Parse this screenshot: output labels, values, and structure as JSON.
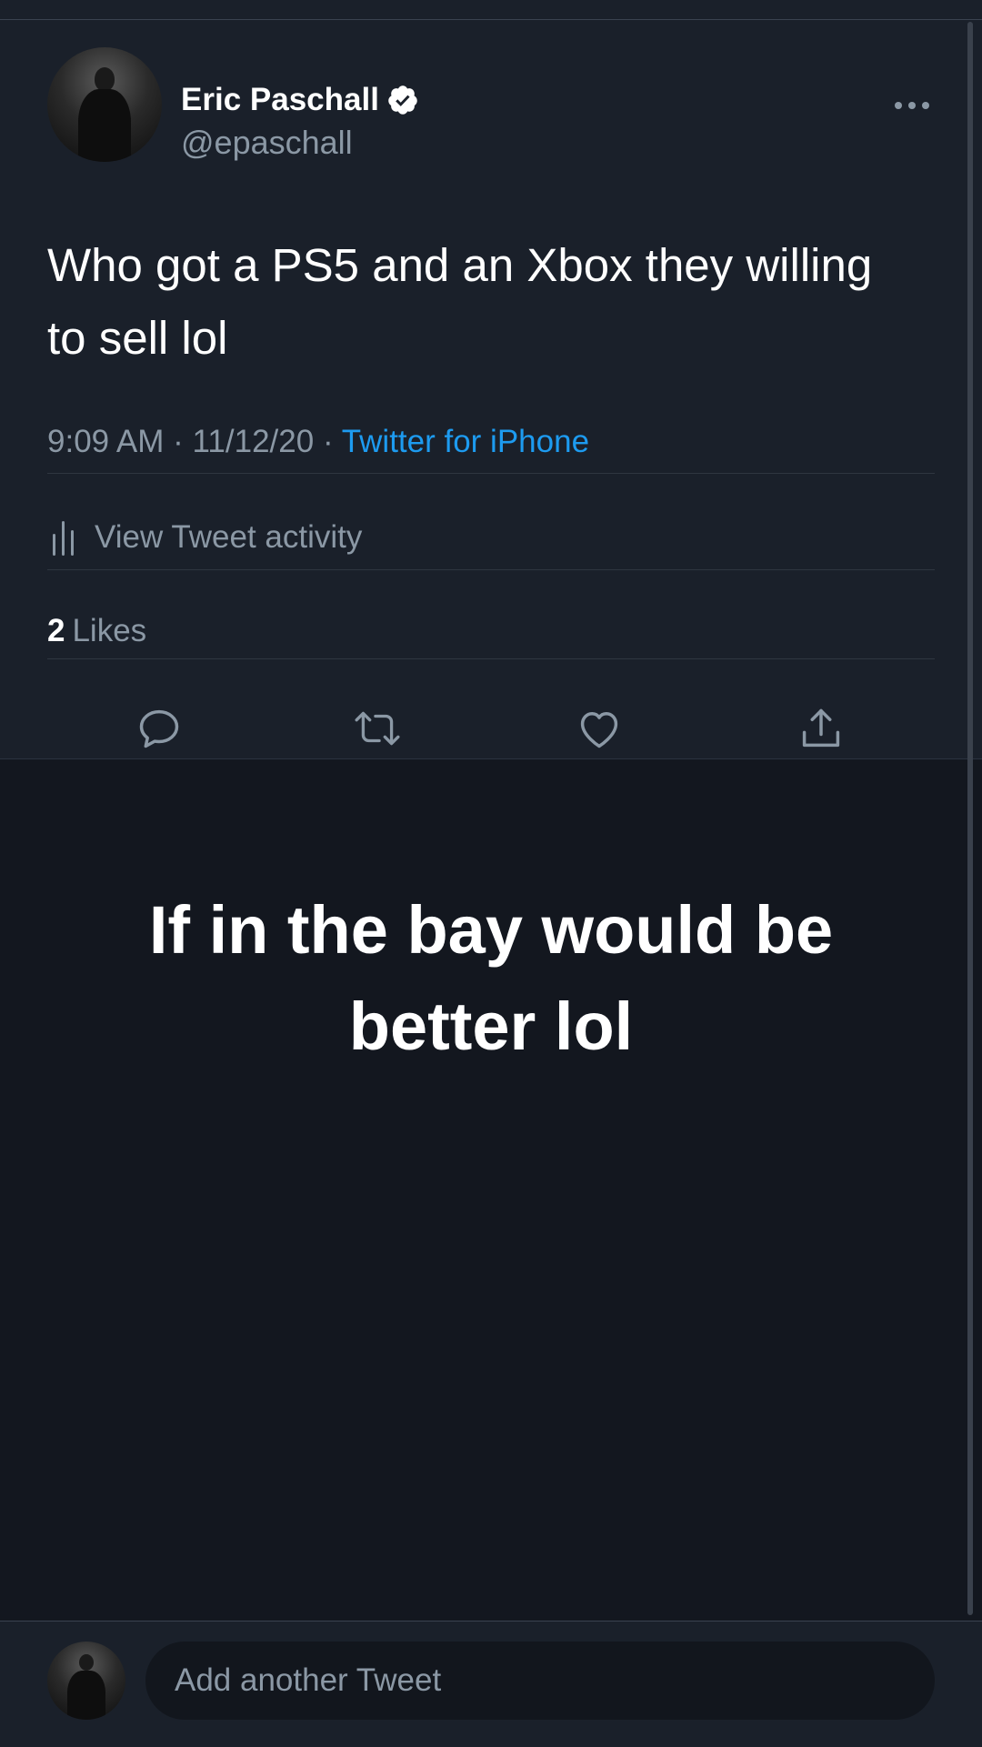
{
  "tweet": {
    "author": {
      "display_name": "Eric Paschall",
      "handle": "@epaschall",
      "verified": true
    },
    "text": "Who got a PS5 and an Xbox they willing to sell lol",
    "time": "9:09 AM",
    "date": "11/12/20",
    "separator": "·",
    "source": "Twitter for iPhone",
    "activity_label": "View Tweet activity",
    "likes_count": "2",
    "likes_label": "Likes"
  },
  "reply_overlay": {
    "text": "If in the bay would be better lol"
  },
  "compose": {
    "placeholder": "Add another Tweet"
  },
  "icons": {
    "verified": "verified-badge-icon",
    "more": "more-options-icon",
    "activity": "bar-chart-icon",
    "reply": "reply-icon",
    "retweet": "retweet-icon",
    "like": "heart-icon",
    "share": "share-icon"
  },
  "colors": {
    "background": "#13171f",
    "card": "#1a202a",
    "text_primary": "#ffffff",
    "text_secondary": "#8b98a5",
    "link": "#1d9bf0"
  }
}
